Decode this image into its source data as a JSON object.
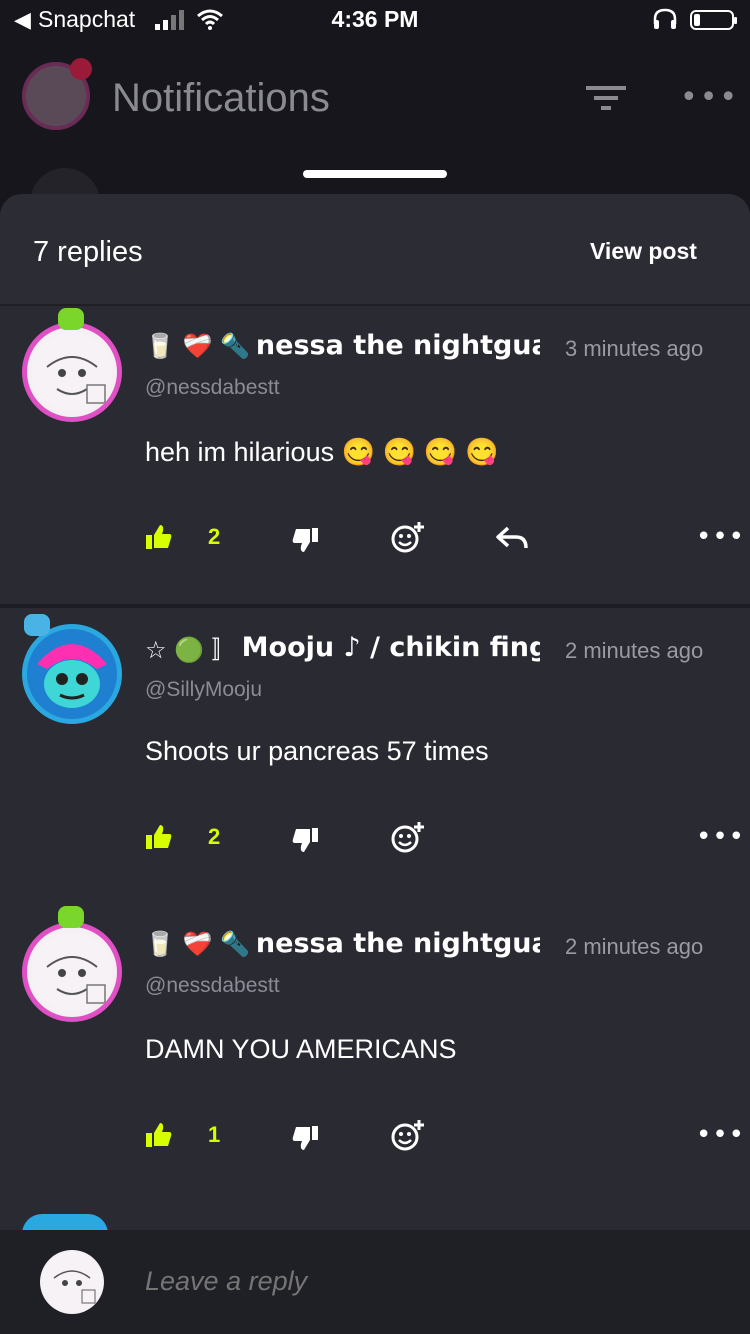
{
  "status_bar": {
    "back_app": "Snapchat",
    "time": "4:36 PM"
  },
  "background": {
    "title": "Notifications"
  },
  "sheet": {
    "reply_count": "7 replies",
    "view_post": "View post"
  },
  "comments": [
    {
      "emojis": "🥛 ❤️‍🩹 🔦",
      "name": "nessa the nightguard",
      "time": "3 minutes ago",
      "handle": "@nessdabestt",
      "text": "heh im hilarious 😋 😋 😋 😋",
      "likes": "2",
      "has_reply": true
    },
    {
      "emojis": "☆ 🟢 〛",
      "name": "Mooju ♪ / chikin fingers",
      "time": "2 minutes ago",
      "handle": "@SillyMooju",
      "text": "Shoots ur pancreas 57 times",
      "likes": "2",
      "has_reply": false
    },
    {
      "emojis": "🥛 ❤️‍🩹 🔦",
      "name": "nessa the nightguard",
      "time": "2 minutes ago",
      "handle": "@nessdabestt",
      "text": "DAMN YOU AMERICANS",
      "likes": "1",
      "has_reply": false
    }
  ],
  "reply_bar": {
    "placeholder": "Leave a reply"
  },
  "colors": {
    "accent_like": "#d8ff00",
    "sheet_bg": "#2a2a33",
    "avatar_pink": "#e04fc4",
    "avatar_blue": "#2aa9e0"
  },
  "icons": [
    "back-arrow-icon",
    "signal-icon",
    "wifi-icon",
    "headphones-icon",
    "battery-icon",
    "filter-icon",
    "more-icon",
    "thumbs-up-icon",
    "thumbs-down-icon",
    "add-reaction-icon",
    "reply-arrow-icon"
  ]
}
